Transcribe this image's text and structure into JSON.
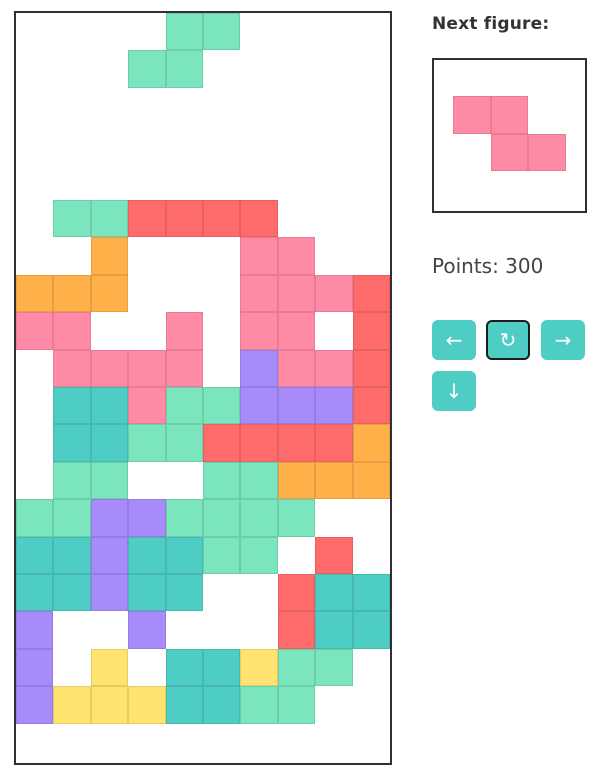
{
  "next_label": "Next figure:",
  "points_label": "Points: 300",
  "colors": {
    "G": "#7be5bd",
    "R": "#ff6b6b",
    "O": "#ffb049",
    "P": "#ff8aa5",
    "V": "#a78bfa",
    "T": "#4ecdc4",
    "Y": "#ffe270"
  },
  "board": [
    "..........",
    "....GG....",
    "...GG.....",
    "..........",
    "..........",
    "..........",
    "..........",
    "..........",
    "..........",
    "..........",
    "..........",
    "..........",
    "..........",
    "..........",
    "..........",
    "..........",
    "..........",
    "..........",
    "..........",
    "..........",
    "..........",
    "..........",
    "..........",
    "..........",
    "..........",
    "..........",
    "..........",
    "..........",
    "..........",
    ".GGRRRR...",
    "..O...PP..",
    "OOO...PPPR",
    "PP..P.PP.R",
    ".PPPP.VPPR",
    ".TTPGGVVVR",
    ".TTGGRRRRO",
    ".GG..GGOOO",
    "GGVVGGGG..",
    "TTVTTGG R.",
    "TTVTT..RTT",
    "V..V...RTT",
    "V.Y.TTYGG.",
    "VYYYTTGG.."
  ],
  "next_piece": {
    "cells": [
      [
        0,
        0
      ],
      [
        1,
        0
      ],
      [
        1,
        1
      ],
      [
        2,
        1
      ]
    ],
    "color": "P"
  },
  "controls": {
    "left": "←",
    "rotate": "↻",
    "right": "→",
    "down": "↓"
  }
}
